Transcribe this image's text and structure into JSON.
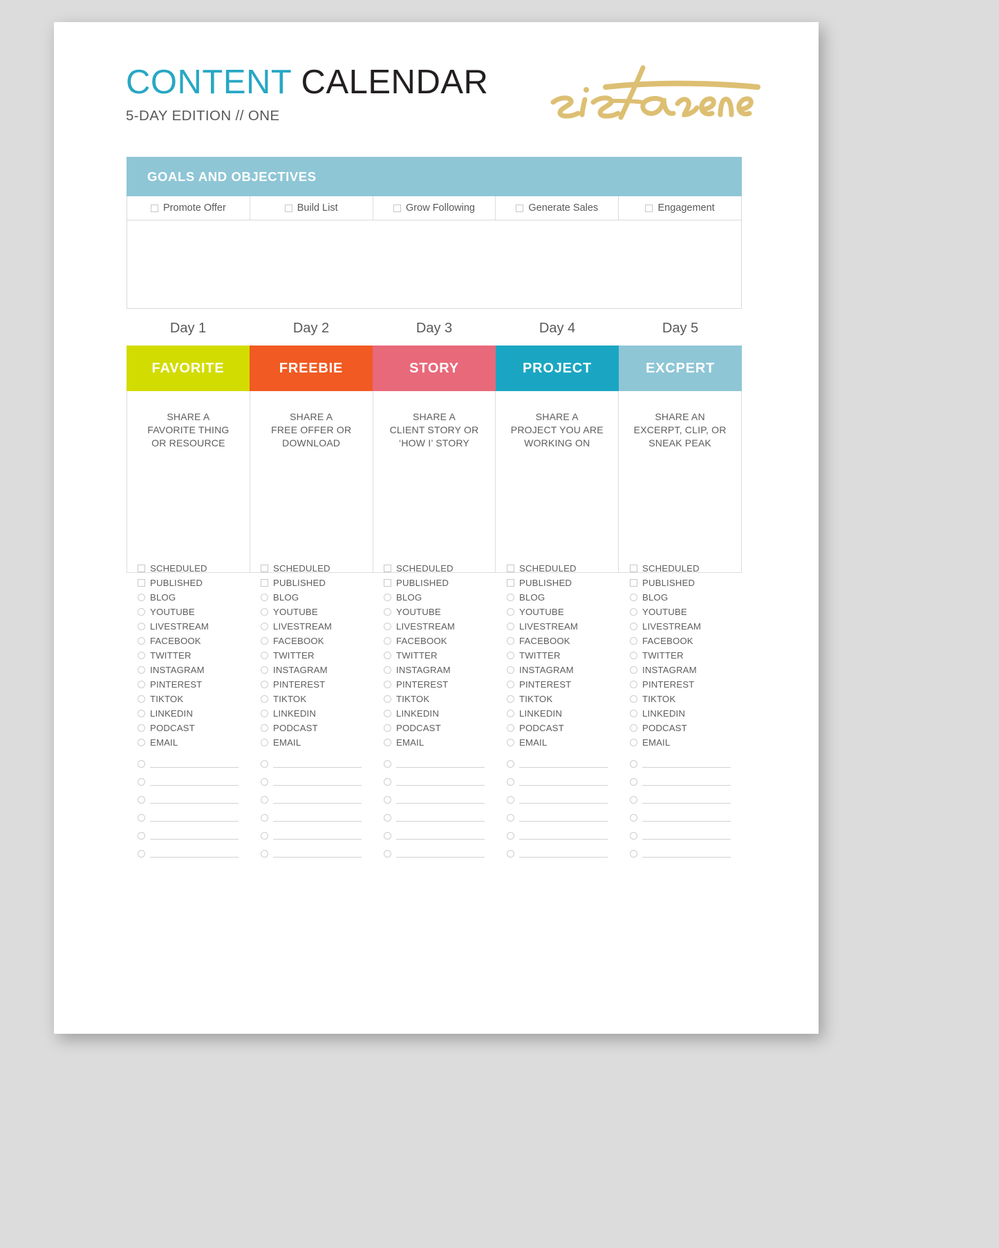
{
  "header": {
    "title_accent": "CONTENT",
    "title_rest": " CALENDAR",
    "subtitle": "5-DAY EDITION //  ONE",
    "logo_text": "sistasense",
    "accent_color": "#28a7c4",
    "logo_color": "#ddbf73"
  },
  "goals": {
    "heading": "GOALS AND OBJECTIVES",
    "heading_bg": "#8ec6d6",
    "options": [
      "Promote Offer",
      "Build List",
      "Grow Following",
      "Generate Sales",
      "Engagement"
    ],
    "notes_value": ""
  },
  "days": [
    {
      "day_label": "Day 1",
      "banner": "FAVORITE",
      "banner_color": "#d2dc00",
      "description": "SHARE A\nFAVORITE THING\nOR RESOURCE",
      "notes_value": ""
    },
    {
      "day_label": "Day 2",
      "banner": "FREEBIE",
      "banner_color": "#f15a22",
      "description": "SHARE A\nFREE OFFER OR\nDOWNLOAD",
      "notes_value": ""
    },
    {
      "day_label": "Day 3",
      "banner": "STORY",
      "banner_color": "#e8697a",
      "description": "SHARE A\nCLIENT STORY OR\n‘HOW I’ STORY",
      "notes_value": ""
    },
    {
      "day_label": "Day 4",
      "banner": "PROJECT",
      "banner_color": "#1aa6c2",
      "description": "SHARE A\nPROJECT YOU ARE\nWORKING ON",
      "notes_value": ""
    },
    {
      "day_label": "Day 5",
      "banner": "EXCPERT",
      "banner_color": "#8ec6d6",
      "description": "SHARE AN\nEXCERPT, CLIP, OR\nSNEAK PEAK",
      "notes_value": ""
    }
  ],
  "checklist": {
    "square_items": [
      "SCHEDULED",
      "PUBLISHED"
    ],
    "circle_items": [
      "BLOG",
      "YOUTUBE",
      "LIVESTREAM",
      "FACEBOOK",
      "TWITTER",
      "INSTAGRAM",
      "PINTEREST",
      "TIKTOK",
      "LINKEDIN",
      "PODCAST",
      "EMAIL"
    ],
    "blank_lines": 6,
    "blank_value": ""
  }
}
